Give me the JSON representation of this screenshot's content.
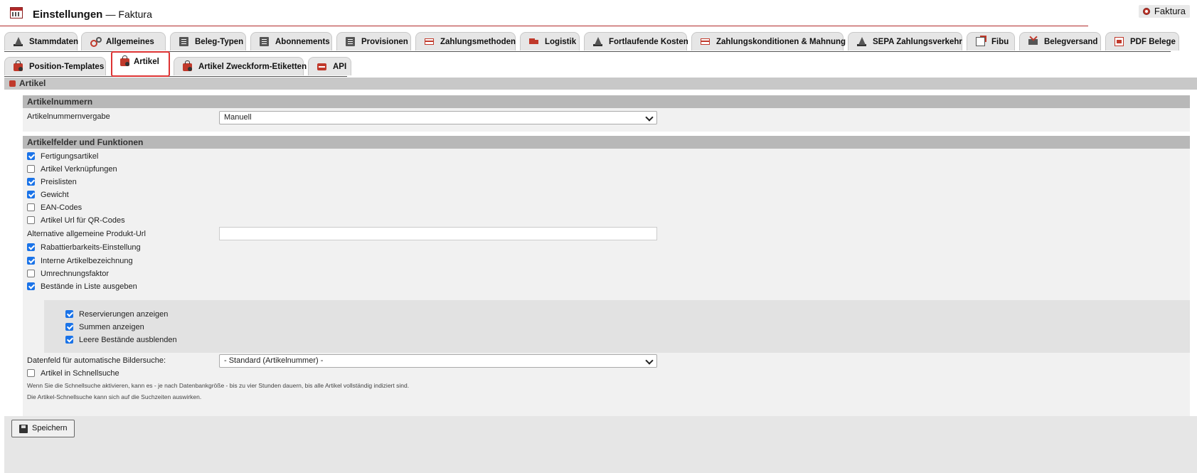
{
  "header": {
    "title": "Einstellungen",
    "subtitle": "— Faktura",
    "module_badge": "Faktura"
  },
  "tabs": {
    "row1": [
      {
        "label": "Stammdaten",
        "icon": "cone-icon"
      },
      {
        "label": "Allgemeines",
        "icon": "gears-icon"
      },
      {
        "label": "Beleg-Typen",
        "icon": "document-icon"
      },
      {
        "label": "Abonnements",
        "icon": "document-icon"
      },
      {
        "label": "Provisionen",
        "icon": "document-icon"
      },
      {
        "label": "Zahlungsmethoden",
        "icon": "card-icon"
      },
      {
        "label": "Logistik",
        "icon": "truck-icon"
      },
      {
        "label": "Fortlaufende Kosten",
        "icon": "cone-icon"
      },
      {
        "label": "Zahlungskonditionen & Mahnung",
        "icon": "card-icon"
      },
      {
        "label": "SEPA Zahlungsverkehr",
        "icon": "cone-icon"
      },
      {
        "label": "Fibu",
        "icon": "export-icon"
      },
      {
        "label": "Belegversand",
        "icon": "send-icon"
      },
      {
        "label": "PDF Belege",
        "icon": "pdf-icon"
      }
    ],
    "row2": [
      {
        "label": "Position-Templates",
        "icon": "bag-icon"
      },
      {
        "label": "Artikel",
        "icon": "bag-icon",
        "active": true
      },
      {
        "label": "Artikel Zweckform-Etiketten",
        "icon": "bag-icon"
      },
      {
        "label": "API",
        "icon": "api-icon"
      }
    ]
  },
  "section": {
    "title": "Artikel"
  },
  "artikelnummern": {
    "heading": "Artikelnummern",
    "vergabe_label": "Artikelnummernvergabe",
    "vergabe_value": "Manuell"
  },
  "felder": {
    "heading": "Artikelfelder und Funktionen",
    "checkboxes": [
      {
        "label": "Fertigungsartikel",
        "checked": true
      },
      {
        "label": "Artikel Verknüpfungen",
        "checked": false
      },
      {
        "label": "Preislisten",
        "checked": true
      },
      {
        "label": "Gewicht",
        "checked": true
      },
      {
        "label": "EAN-Codes",
        "checked": false
      },
      {
        "label": "Artikel Url für QR-Codes",
        "checked": false
      }
    ],
    "produkt_url_label": "Alternative allgemeine Produkt-Url",
    "produkt_url_value": "",
    "checkboxes2": [
      {
        "label": "Rabattierbarkeits-Einstellung",
        "checked": true
      },
      {
        "label": "Interne Artikelbezeichnung",
        "checked": true
      },
      {
        "label": "Umrechnungsfaktor",
        "checked": false
      },
      {
        "label": "Bestände in Liste ausgeben",
        "checked": true
      }
    ],
    "sub_checkboxes": [
      {
        "label": "Reservierungen anzeigen",
        "checked": true
      },
      {
        "label": "Summen anzeigen",
        "checked": true
      },
      {
        "label": "Leere Bestände ausblenden",
        "checked": true
      }
    ],
    "bildersuche_label": "Datenfeld für automatische Bildersuche:",
    "bildersuche_value": "- Standard (Artikelnummer) -",
    "schnellsuche_label": "Artikel in Schnellsuche",
    "schnellsuche_checked": false,
    "hint1": "Wenn Sie die Schnellsuche aktivieren, kann es - je nach Datenbankgröße - bis zu vier Stunden dauern, bis alle Artikel vollständig indiziert sind.",
    "hint2": "Die Artikel-Schnellsuche kann sich auf die Suchzeiten auswirken."
  },
  "footer": {
    "save_label": "Speichern"
  }
}
